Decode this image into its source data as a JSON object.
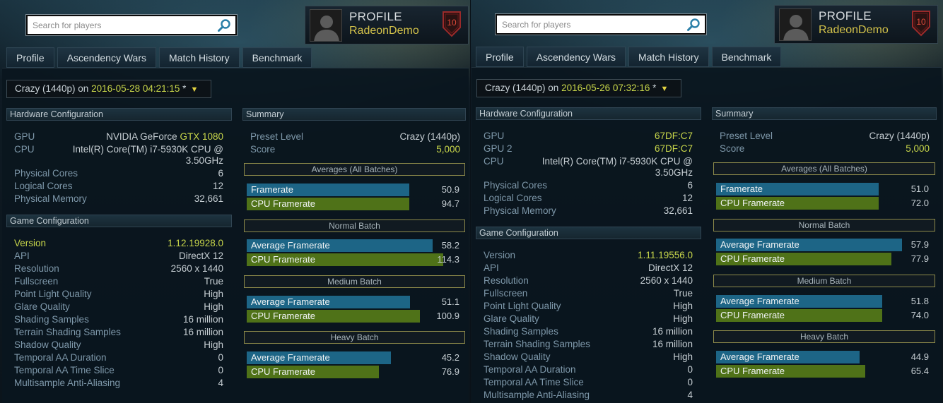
{
  "search": {
    "placeholder": "Search for players"
  },
  "profile": {
    "label": "PROFILE",
    "name": "RadeonDemo",
    "level": "10"
  },
  "tabs": [
    "Profile",
    "Ascendency Wars",
    "Match History",
    "Benchmark"
  ],
  "colors": {
    "accent_yellow": "#c8d64a",
    "bar_blue": "#1d6586",
    "bar_green": "#4f7218"
  },
  "left": {
    "run": {
      "prefix": "Crazy (1440p) on ",
      "date": "2016-05-28 04:21:15",
      "suffix": " *"
    },
    "hardware_title": "Hardware Configuration",
    "hw": [
      {
        "k": "GPU",
        "v1": "NVIDIA GeForce ",
        "v2": "GTX 1080"
      },
      {
        "k": "CPU",
        "v": "Intel(R) Core(TM) i7-5930K CPU @ 3.50GHz"
      },
      {
        "k": "Physical Cores",
        "v": "6"
      },
      {
        "k": "Logical Cores",
        "v": "12"
      },
      {
        "k": "Physical Memory",
        "v": "32,661"
      }
    ],
    "game_title": "Game Configuration",
    "game": [
      {
        "k": "Version",
        "v": "1.12.19928.0"
      },
      {
        "k": "API",
        "v": "DirectX 12"
      },
      {
        "k": "Resolution",
        "v": "2560 x 1440"
      },
      {
        "k": "Fullscreen",
        "v": "True"
      },
      {
        "k": "Point Light Quality",
        "v": "High"
      },
      {
        "k": "Glare Quality",
        "v": "High"
      },
      {
        "k": "Shading Samples",
        "v": "16 million"
      },
      {
        "k": "Terrain Shading Samples",
        "v": "16 million"
      },
      {
        "k": "Shadow Quality",
        "v": "High"
      },
      {
        "k": "Temporal AA Duration",
        "v": "0"
      },
      {
        "k": "Temporal AA Time Slice",
        "v": "0"
      },
      {
        "k": "Multisample Anti-Aliasing",
        "v": "4"
      }
    ],
    "summary_title": "Summary",
    "summary": [
      {
        "k": "Preset Level",
        "v": "Crazy (1440p)"
      },
      {
        "k": "Score",
        "v": "5,000"
      }
    ],
    "averages_title": "Averages (All Batches)",
    "averages": [
      {
        "label": "Framerate",
        "value": "50.9",
        "fill": 0.754
      },
      {
        "label": "CPU Framerate",
        "value": "94.7",
        "fill": 0.754
      }
    ],
    "normal_title": "Normal Batch",
    "normal": [
      {
        "label": "Average Framerate",
        "value": "58.2",
        "fill": 0.862
      },
      {
        "label": "CPU Framerate",
        "value": "114.3",
        "fill": 0.911
      }
    ],
    "medium_title": "Medium Batch",
    "medium": [
      {
        "label": "Average Framerate",
        "value": "51.1",
        "fill": 0.757
      },
      {
        "label": "CPU Framerate",
        "value": "100.9",
        "fill": 0.803
      }
    ],
    "heavy_title": "Heavy Batch",
    "heavy": [
      {
        "label": "Average Framerate",
        "value": "45.2",
        "fill": 0.669
      },
      {
        "label": "CPU Framerate",
        "value": "76.9",
        "fill": 0.612
      }
    ]
  },
  "right": {
    "run": {
      "prefix": "Crazy (1440p) on ",
      "date": "2016-05-26 07:32:16",
      "suffix": " *"
    },
    "hardware_title": "Hardware Configuration",
    "hw": [
      {
        "k": "GPU",
        "v": "67DF:C7"
      },
      {
        "k": "GPU 2",
        "v": "67DF:C7"
      },
      {
        "k": "CPU",
        "v": "Intel(R) Core(TM) i7-5930K CPU @ 3.50GHz"
      },
      {
        "k": "Physical Cores",
        "v": "6"
      },
      {
        "k": "Logical Cores",
        "v": "12"
      },
      {
        "k": "Physical Memory",
        "v": "32,661"
      }
    ],
    "game_title": "Game Configuration",
    "game": [
      {
        "k": "Version",
        "v": "1.11.19556.0"
      },
      {
        "k": "API",
        "v": "DirectX 12"
      },
      {
        "k": "Resolution",
        "v": "2560 x 1440"
      },
      {
        "k": "Fullscreen",
        "v": "True"
      },
      {
        "k": "Point Light Quality",
        "v": "High"
      },
      {
        "k": "Glare Quality",
        "v": "High"
      },
      {
        "k": "Shading Samples",
        "v": "16 million"
      },
      {
        "k": "Terrain Shading Samples",
        "v": "16 million"
      },
      {
        "k": "Shadow Quality",
        "v": "High"
      },
      {
        "k": "Temporal AA Duration",
        "v": "0"
      },
      {
        "k": "Temporal AA Time Slice",
        "v": "0"
      },
      {
        "k": "Multisample Anti-Aliasing",
        "v": "4"
      }
    ],
    "summary_title": "Summary",
    "summary": [
      {
        "k": "Preset Level",
        "v": "Crazy (1440p)"
      },
      {
        "k": "Score",
        "v": "5,000"
      }
    ],
    "averages_title": "Averages (All Batches)",
    "averages": [
      {
        "label": "Framerate",
        "value": "51.0",
        "fill": 0.754
      },
      {
        "label": "CPU Framerate",
        "value": "72.0",
        "fill": 0.754
      }
    ],
    "normal_title": "Normal Batch",
    "normal": [
      {
        "label": "Average Framerate",
        "value": "57.9",
        "fill": 0.862
      },
      {
        "label": "CPU Framerate",
        "value": "77.9",
        "fill": 0.813
      }
    ],
    "medium_title": "Medium Batch",
    "medium": [
      {
        "label": "Average Framerate",
        "value": "51.8",
        "fill": 0.77
      },
      {
        "label": "CPU Framerate",
        "value": "74.0",
        "fill": 0.77
      }
    ],
    "heavy_title": "Heavy Batch",
    "heavy": [
      {
        "label": "Average Framerate",
        "value": "44.9",
        "fill": 0.666
      },
      {
        "label": "CPU Framerate",
        "value": "65.4",
        "fill": 0.692
      }
    ]
  }
}
